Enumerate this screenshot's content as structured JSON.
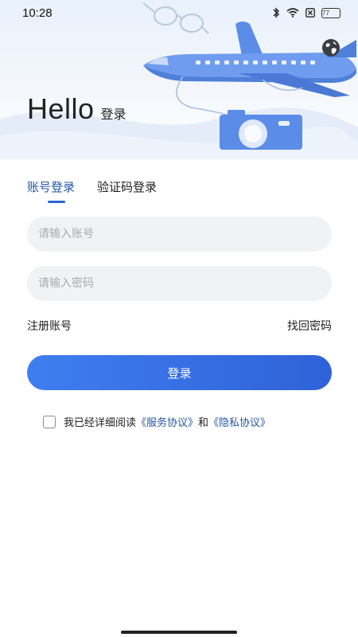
{
  "status_bar": {
    "time": "10:28",
    "battery": "77",
    "icons": [
      "bluetooth-icon",
      "wifi-icon",
      "sim-off-icon",
      "battery-icon"
    ]
  },
  "header": {
    "title_big": "Hello",
    "title_small": "登录",
    "language_icon": "globe-icon"
  },
  "tabs": [
    {
      "label": "账号登录",
      "active": true
    },
    {
      "label": "验证码登录",
      "active": false
    }
  ],
  "form": {
    "account_placeholder": "请输入账号",
    "password_placeholder": "请输入密码",
    "register_label": "注册账号",
    "forgot_label": "找回密码",
    "login_button": "登录"
  },
  "agreement": {
    "prefix": "我已经详细阅读",
    "service_link": "《服务协议》",
    "conjunction": "和",
    "privacy_link": "《隐私协议》",
    "checked": false
  },
  "colors": {
    "accent": "#2f62d8",
    "link": "#2456a8",
    "input_bg": "#f1f2f4"
  }
}
